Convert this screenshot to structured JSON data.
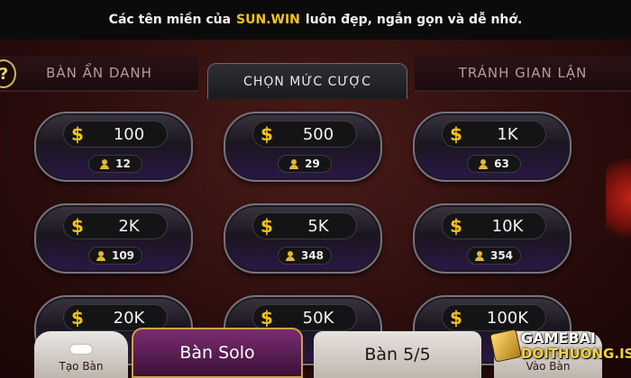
{
  "banner": {
    "prefix": "Các tên miền của",
    "highlight": "SUN.WIN",
    "suffix": "luôn đẹp, ngắn gọn và dễ nhớ."
  },
  "help_label": "?",
  "tabs": [
    {
      "label": "BÀN ẨN DANH"
    },
    {
      "label": "CHỌN MỨC CƯỢC"
    },
    {
      "label": "TRÁNH GIAN LẬN"
    }
  ],
  "cards": [
    {
      "currency": "$",
      "amount": "100",
      "players": "12"
    },
    {
      "currency": "$",
      "amount": "500",
      "players": "29"
    },
    {
      "currency": "$",
      "amount": "1K",
      "players": "63"
    },
    {
      "currency": "$",
      "amount": "2K",
      "players": "109"
    },
    {
      "currency": "$",
      "amount": "5K",
      "players": "348"
    },
    {
      "currency": "$",
      "amount": "10K",
      "players": "354"
    },
    {
      "currency": "$",
      "amount": "20K",
      "players": ""
    },
    {
      "currency": "$",
      "amount": "50K",
      "players": ""
    },
    {
      "currency": "$",
      "amount": "100K",
      "players": ""
    }
  ],
  "bottom": {
    "create_label": "Tạo Bàn",
    "solo_label": "Bàn Solo",
    "room_label": "Bàn 5/5",
    "join_label": "Vào Bàn"
  },
  "watermark": {
    "line1": "GAMEBAI",
    "line2": "DOITHUONG.IS"
  },
  "colors": {
    "accent_gold": "#f1c21a",
    "solo_purple": "#7a2c70"
  }
}
